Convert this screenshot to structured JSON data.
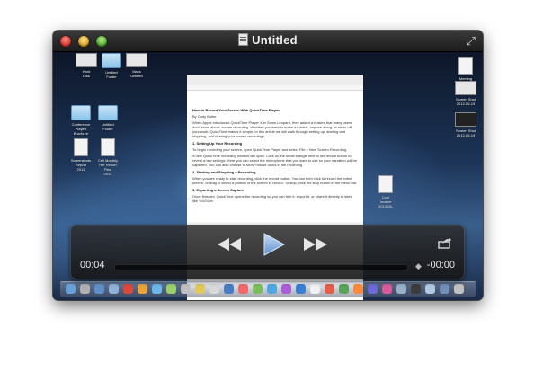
{
  "window": {
    "title": "Untitled",
    "fullscreen_glyph": "⤢"
  },
  "desktop": {
    "left_icons": [
      {
        "label": "Hard\nDisk"
      },
      {
        "label": "Untitled\nFolder"
      },
      {
        "label": "Macs\nUntitled"
      },
      {
        "label": "Conference\nPlaylist\nBrochure"
      },
      {
        "label": "Untitled\nFolder"
      },
      {
        "label": "Screenshots\nReport\n2012"
      },
      {
        "label": "Cell Monthly\nHer Report\nPlan\n2012"
      }
    ],
    "right_icons": [
      {
        "label": "Meeting\nNotes"
      },
      {
        "label": "Screen Shot\n2012-06-19"
      },
      {
        "label": "Screen Shot\n2012-06-19"
      },
      {
        "label": "Cont\nInvoice\n2013-06-"
      }
    ]
  },
  "document": {
    "title": "How to Record Your Screen With QuickTime Player",
    "byline": "By Cody Butler",
    "intro": "When Apple introduced QuickTime Player X in Snow Leopard, they added a feature that many users don't know about: screen recording. Whether you want to make a tutorial, capture a bug, or show off your work, QuickTime makes it simple. In this article we will walk through setting up, starting and stopping, and sharing your screen recordings.",
    "section1": "1. Setting Up Your Recording",
    "section1_body": "To begin recording your screen, open QuickTime Player and select File > New Screen Recording.",
    "section1_body2": "A new QuickTime recording window will open. Click on the small triangle next to the record button to reveal a few settings. Here you can select the microphone that you want to use so your narration will be captured. You can also choose to show mouse clicks in the recording.",
    "section2": "2. Starting and Stopping a Recording",
    "section2_body": "When you are ready to start recording, click the record button. You can then click to record the entire screen, or drag to select a portion of the screen to record. To stop, click the stop button in the menu bar.",
    "section3": "3. Exporting a Screen Capture",
    "section3_body": "Once finished, QuickTime opens the recording so you can trim it, export it, or share it directly to sites like YouTube."
  },
  "controls": {
    "elapsed": "00:04",
    "remaining": "-00:00",
    "progress_fraction": 0.95
  },
  "dock": {
    "icon_colors": [
      "#6aa0d8",
      "#b0b0b0",
      "#5f8fc9",
      "#8fb1d8",
      "#d84a3a",
      "#e8a33a",
      "#6cb7e8",
      "#9ad06a",
      "#c0c0c0",
      "#e3c95a",
      "#d9d9d9",
      "#4a7cc2",
      "#f06a6a",
      "#7bbd5a",
      "#50a8e0",
      "#a85fd8",
      "#3c7fd0",
      "#f2f2f2",
      "#e0604a",
      "#5aa35a",
      "#ff8a3a",
      "#6a6ad8",
      "#d85a9a",
      "#9ab0c8",
      "#3c3c3c",
      "#b0c8e0",
      "#7090b8",
      "#c0c0c0"
    ]
  }
}
